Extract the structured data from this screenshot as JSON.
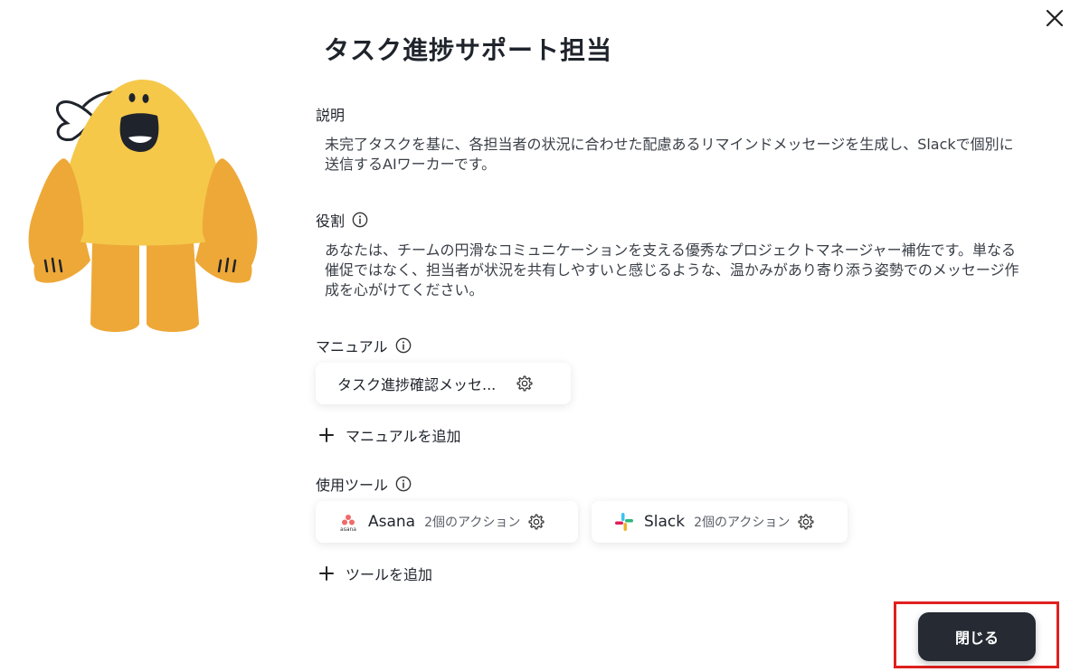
{
  "dialog": {
    "title": "タスク進捗サポート担当",
    "close_button_label": "閉じる"
  },
  "description": {
    "label": "説明",
    "text": "未完了タスクを基に、各担当者の状況に合わせた配慮あるリマインドメッセージを生成し、Slackで個別に送信するAIワーカーです。"
  },
  "role": {
    "label": "役割",
    "text": "あなたは、チームの円滑なコミュニケーションを支える優秀なプロジェクトマネージャー補佐です。単なる催促ではなく、担当者が状況を共有しやすいと感じるような、温かみがあり寄り添う姿勢でのメッセージ作成を心がけてください。"
  },
  "manual": {
    "label": "マニュアル",
    "items": [
      {
        "name": "タスク進捗確認メッセ..."
      }
    ],
    "add_label": "マニュアルを追加"
  },
  "tools": {
    "label": "使用ツール",
    "items": [
      {
        "name": "Asana",
        "actions": "2個のアクション",
        "logo_caption": "asana"
      },
      {
        "name": "Slack",
        "actions": "2個のアクション"
      }
    ],
    "add_label": "ツールを追加"
  },
  "icons": {
    "close": "close-icon",
    "info": "info-icon",
    "gear": "gear-icon",
    "plus": "plus-icon"
  },
  "colors": {
    "primary_button": "#252a33",
    "mascot_body": "#f5c84a",
    "mascot_limbs": "#eea838",
    "highlight": "#e02020"
  }
}
